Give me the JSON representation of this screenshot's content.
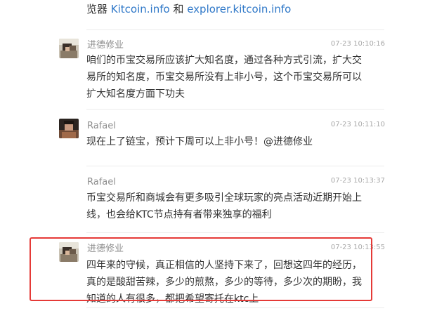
{
  "top": {
    "prefix": "览器 ",
    "link1": "Kitcoin.info",
    "middle": " 和 ",
    "link2": "explorer.kitcoin.info"
  },
  "messages": [
    {
      "name": "进德修业",
      "time": "07-23 10:10:16",
      "text": "咱们的币宝交易所应该扩大知名度，通过各种方式引流，扩大交易所的知名度，币宝交易所没有上非小号，这个币宝交易所可以扩大知名度方面下功夫"
    },
    {
      "name": "Rafael",
      "time": "07-23 10:11:10",
      "text": "现在上了链宝，预计下周可以上非小号！@进德修业"
    },
    {
      "name": "Rafael",
      "time": "07-23 10:13:37",
      "text": "币宝交易所和商城会有更多吸引全球玩家的亮点活动近期开始上线，也会给KTC节点持有者带来独享的福利"
    },
    {
      "name": "进德修业",
      "time": "07-23 10:13:55",
      "text": "四年来的守候，真正相信的人坚持下来了，回想这四年的经历，真的是酸甜苦辣，多少的煎熬，多少的等待，多少次的期盼，我知道的人有很多，都把希望寄托在ktc上"
    }
  ],
  "colors": {
    "highlight": "#e53a37",
    "link": "#2f78c8"
  },
  "icons": {
    "avatar_jindexiuye": "user-photo-avatar",
    "avatar_rafael": "user-photo-avatar"
  }
}
